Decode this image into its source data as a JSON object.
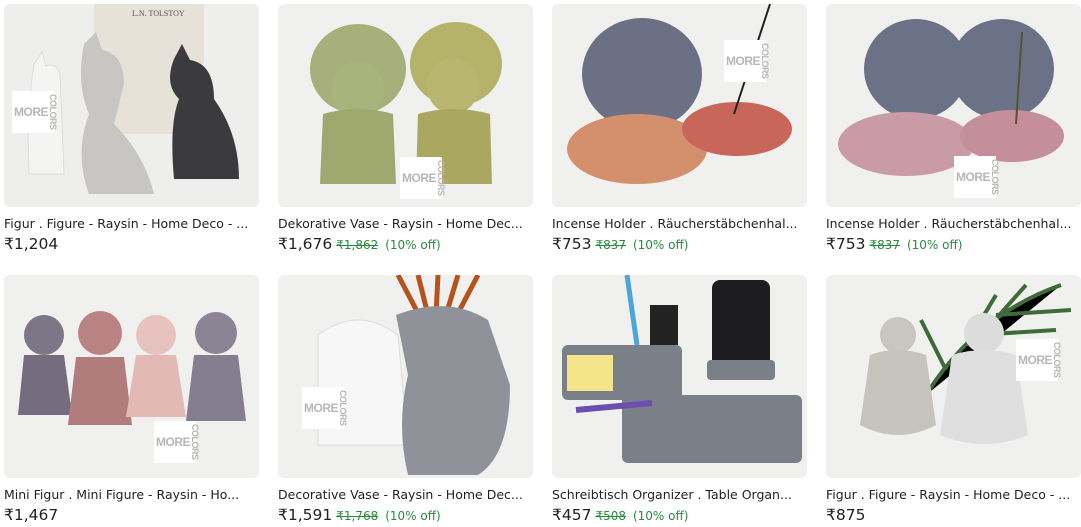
{
  "badge": {
    "more": "MORE",
    "colors": "COLORS"
  },
  "book_title": "L.N. TOLSTOY",
  "products": [
    {
      "title": "Figur . Figure - Raysin - Home Deco - ...",
      "price": "₹1,204",
      "original": "",
      "discount": ""
    },
    {
      "title": "Dekorative Vase - Raysin - Home Dec...",
      "price": "₹1,676",
      "original": "₹1,862",
      "discount": "(10% off)"
    },
    {
      "title": "Incense Holder . Räucherstäbchenhal...",
      "price": "₹753",
      "original": "₹837",
      "discount": "(10% off)"
    },
    {
      "title": "Incense Holder . Räucherstäbchenhal...",
      "price": "₹753",
      "original": "₹837",
      "discount": "(10% off)"
    },
    {
      "title": "Mini Figur . Mini Figure - Raysin - Ho...",
      "price": "₹1,467",
      "original": "",
      "discount": ""
    },
    {
      "title": "Decorative Vase - Raysin - Home Dec...",
      "price": "₹1,591",
      "original": "₹1,768",
      "discount": "(10% off)"
    },
    {
      "title": "Schreibtisch Organizer . Table Organ...",
      "price": "₹457",
      "original": "₹508",
      "discount": "(10% off)"
    },
    {
      "title": "Figur . Figure - Raysin - Home Deco - ...",
      "price": "₹875",
      "original": "",
      "discount": ""
    }
  ],
  "colors": {
    "discount_green": "#2a8a3e",
    "text": "#222222"
  }
}
